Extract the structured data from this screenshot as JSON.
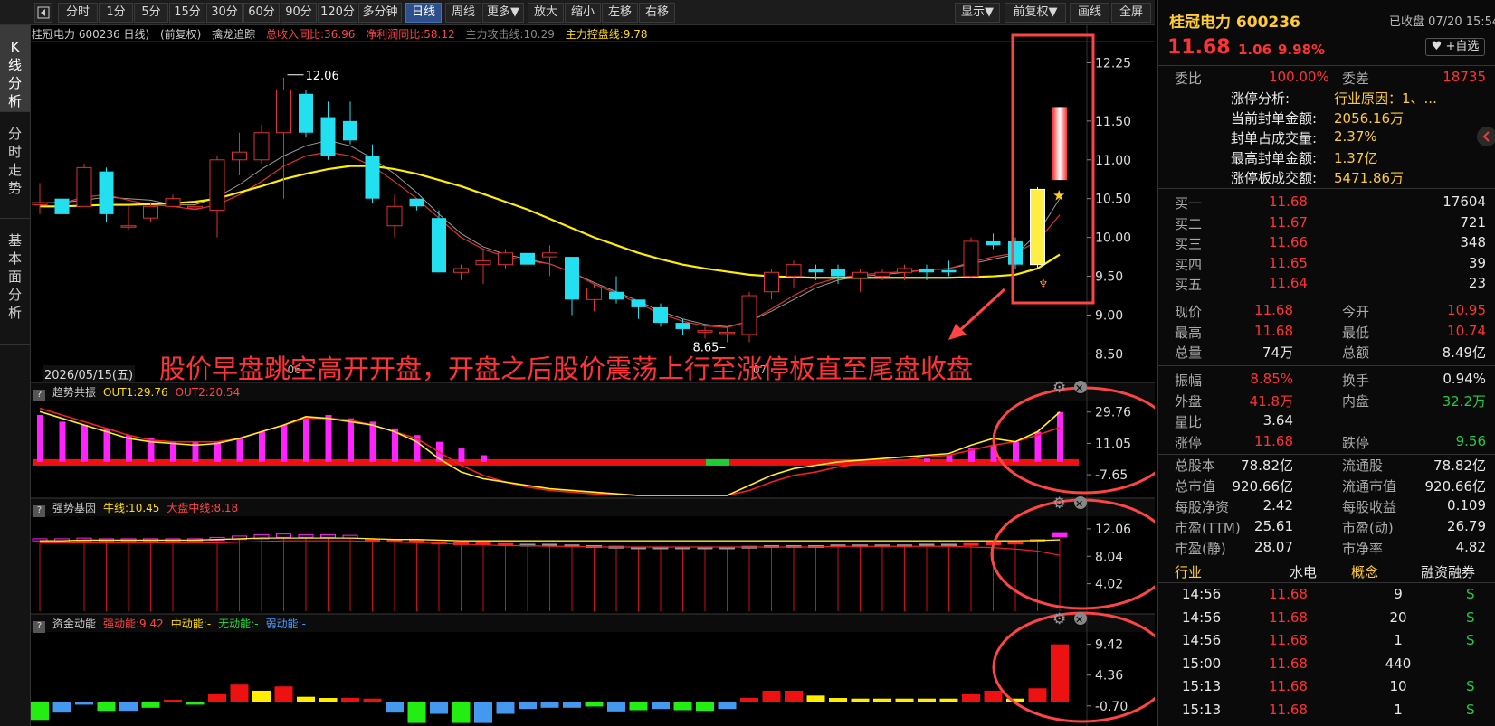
{
  "toolbar": {
    "back_icon": "back-arrow-icon",
    "periods": [
      "分时",
      "1分",
      "5分",
      "15分",
      "30分",
      "60分",
      "90分",
      "120分",
      "多分钟",
      "日线",
      "周线",
      "更多▼",
      "放大",
      "缩小",
      "左移",
      "右移"
    ],
    "active_period": "日线",
    "display": "显示▼",
    "adjust": "前复权▼",
    "draw": "画线",
    "fullscreen": "全屏"
  },
  "side_tabs": [
    "K\n线\n分\n析",
    "分\n时\n走\n势",
    "基\n本\n面\n分\n析"
  ],
  "main_chart": {
    "header_title": "桂冠电力 600236 日线)",
    "header_adjust": "(前复权)",
    "indicator_name": "擒龙追踪",
    "stat1": "总收入同比:36.96",
    "stat2": "净利润同比:58.12",
    "stat3": "主力攻击线:10.29",
    "stat4": "主力控盘线:9.78",
    "high_label": "12.06",
    "low_label": "8.65",
    "date_label": "2026/05/15(五)",
    "tick_06": "06",
    "tick_07": "07",
    "annotation": "股价早盘跳空高开开盘，开盘之后股价震荡上行至涨停板直至尾盘收盘"
  },
  "indicator1": {
    "name": "趋势共振",
    "out1": "OUT1:29.76",
    "out2": "OUT2:20.54",
    "gear_icon": "gear-icon",
    "close_icon": "close-icon"
  },
  "indicator2": {
    "name": "强势基因",
    "l1": "牛线:10.45",
    "l2": "大盘中线:8.18",
    "gear_icon": "gear-icon",
    "close_icon": "close-icon"
  },
  "indicator3": {
    "name": "资金动能",
    "l1": "强动能:9.42",
    "l2": "中动能:-",
    "l3": "无动能:-",
    "l4": "弱动能:-",
    "gear_icon": "gear-icon",
    "close_icon": "close-icon"
  },
  "chart_data": [
    {
      "type": "candlestick",
      "title": "桂冠电力 600236 日线",
      "y_ticks": [
        12.25,
        11.5,
        11.0,
        10.5,
        10.0,
        9.5,
        9.0,
        8.5
      ],
      "y_tick_labels": [
        "12.25",
        "11.50",
        "11.00",
        "10.50",
        "10.00",
        "9.50",
        "9.00",
        "8.50"
      ],
      "ylim": [
        8.4,
        12.5
      ],
      "ohlc": [
        [
          10.42,
          10.7,
          10.3,
          10.45
        ],
        [
          10.5,
          10.55,
          10.25,
          10.3
        ],
        [
          10.4,
          10.95,
          10.4,
          10.9
        ],
        [
          10.85,
          10.9,
          10.2,
          10.3
        ],
        [
          10.15,
          10.4,
          10.1,
          10.15
        ],
        [
          10.25,
          10.45,
          10.2,
          10.4
        ],
        [
          10.4,
          10.55,
          10.4,
          10.5
        ],
        [
          10.38,
          10.6,
          10.05,
          10.4
        ],
        [
          10.35,
          11.05,
          10.0,
          11.0
        ],
        [
          11.0,
          11.35,
          10.8,
          11.1
        ],
        [
          11.0,
          11.45,
          10.95,
          11.35
        ],
        [
          11.35,
          12.06,
          10.5,
          11.9
        ],
        [
          11.85,
          11.9,
          11.3,
          11.35
        ],
        [
          11.55,
          11.75,
          11.0,
          11.05
        ],
        [
          11.5,
          11.75,
          11.2,
          11.25
        ],
        [
          11.05,
          11.2,
          10.45,
          10.5
        ],
        [
          10.15,
          10.55,
          10.0,
          10.4
        ],
        [
          10.5,
          10.5,
          10.35,
          10.4
        ],
        [
          10.25,
          10.35,
          9.55,
          9.55
        ],
        [
          9.55,
          9.65,
          9.45,
          9.6
        ],
        [
          9.65,
          9.85,
          9.4,
          9.7
        ],
        [
          9.65,
          9.85,
          9.6,
          9.8
        ],
        [
          9.8,
          9.8,
          9.65,
          9.65
        ],
        [
          9.75,
          9.9,
          9.5,
          9.8
        ],
        [
          9.75,
          9.75,
          9.0,
          9.2
        ],
        [
          9.2,
          9.4,
          9.05,
          9.35
        ],
        [
          9.3,
          9.5,
          9.15,
          9.2
        ],
        [
          9.2,
          9.2,
          8.95,
          9.1
        ],
        [
          9.1,
          9.15,
          8.85,
          8.9
        ],
        [
          8.9,
          8.95,
          8.75,
          8.82
        ],
        [
          8.78,
          8.85,
          8.7,
          8.8
        ],
        [
          8.78,
          8.85,
          8.65,
          8.78
        ],
        [
          8.75,
          9.3,
          8.65,
          9.25
        ],
        [
          9.3,
          9.6,
          9.2,
          9.55
        ],
        [
          9.5,
          9.7,
          9.35,
          9.65
        ],
        [
          9.6,
          9.65,
          9.45,
          9.55
        ],
        [
          9.6,
          9.65,
          9.4,
          9.5
        ],
        [
          9.48,
          9.6,
          9.3,
          9.55
        ],
        [
          9.5,
          9.6,
          9.45,
          9.55
        ],
        [
          9.55,
          9.65,
          9.45,
          9.6
        ],
        [
          9.6,
          9.65,
          9.45,
          9.55
        ],
        [
          9.58,
          9.7,
          9.5,
          9.55
        ],
        [
          9.5,
          10.0,
          9.48,
          9.95
        ],
        [
          9.95,
          10.05,
          9.85,
          9.9
        ],
        [
          9.95,
          10.0,
          9.6,
          9.65
        ],
        [
          9.65,
          10.65,
          9.6,
          10.62
        ],
        [
          10.95,
          11.68,
          10.74,
          11.68
        ]
      ],
      "ma_gray": [
        10.45,
        10.45,
        10.48,
        10.52,
        10.5,
        10.48,
        10.42,
        10.42,
        10.52,
        10.68,
        10.88,
        11.05,
        11.18,
        11.25,
        11.18,
        11.02,
        10.82,
        10.58,
        10.3,
        10.05,
        9.88,
        9.78,
        9.72,
        9.66,
        9.55,
        9.42,
        9.3,
        9.18,
        9.05,
        8.95,
        8.88,
        8.85,
        8.92,
        9.05,
        9.2,
        9.35,
        9.45,
        9.5,
        9.52,
        9.55,
        9.58,
        9.6,
        9.66,
        9.72,
        9.78,
        10.05,
        10.5
      ],
      "ma_red": [
        10.45,
        10.44,
        10.52,
        10.55,
        10.48,
        10.42,
        10.4,
        10.36,
        10.42,
        10.55,
        10.72,
        10.92,
        11.05,
        11.1,
        11.05,
        10.92,
        10.72,
        10.5,
        10.25,
        10.0,
        9.85,
        9.75,
        9.7,
        9.66,
        9.55,
        9.4,
        9.28,
        9.15,
        9.02,
        8.92,
        8.86,
        8.84,
        8.92,
        9.08,
        9.25,
        9.4,
        9.48,
        9.52,
        9.54,
        9.56,
        9.58,
        9.6,
        9.68,
        9.75,
        9.8,
        9.95,
        10.29
      ],
      "ma_yellow": [
        10.4,
        10.4,
        10.41,
        10.42,
        10.42,
        10.43,
        10.44,
        10.46,
        10.5,
        10.58,
        10.66,
        10.75,
        10.82,
        10.88,
        10.92,
        10.92,
        10.88,
        10.82,
        10.74,
        10.66,
        10.56,
        10.46,
        10.36,
        10.24,
        10.12,
        10.0,
        9.9,
        9.8,
        9.72,
        9.65,
        9.6,
        9.56,
        9.52,
        9.5,
        9.49,
        9.48,
        9.48,
        9.48,
        9.48,
        9.48,
        9.48,
        9.48,
        9.49,
        9.5,
        9.52,
        9.6,
        9.78
      ]
    },
    {
      "type": "bar",
      "title": "趋势共振",
      "y_tick_labels": [
        "29.76",
        "11.05",
        "-7.65"
      ],
      "ylim": [
        -20,
        35
      ],
      "values": [
        28,
        24,
        22,
        20,
        16,
        14,
        12,
        12,
        12,
        14,
        18,
        22,
        26,
        28,
        26,
        24,
        20,
        16,
        12,
        8,
        4,
        0,
        -4,
        -8,
        -12,
        -16,
        -20,
        -20,
        -20,
        -20,
        -20,
        -20,
        -18,
        -14,
        -10,
        -8,
        -6,
        -4,
        -2,
        0,
        2,
        4,
        8,
        10,
        12,
        18,
        29.76
      ],
      "line_yellow": [
        30,
        26,
        22,
        18,
        14,
        12,
        11,
        10,
        11,
        14,
        18,
        22,
        27,
        26,
        24,
        22,
        18,
        12,
        2,
        -6,
        -10,
        -12,
        -14,
        -16,
        -17,
        -18,
        -19,
        -20,
        -20,
        -20,
        -20,
        -20,
        -14,
        -8,
        -4,
        -2,
        0,
        1,
        2,
        3,
        4,
        5,
        10,
        14,
        12,
        18,
        29.76
      ],
      "line_red": [
        32,
        28,
        24,
        20,
        16,
        13,
        12,
        12,
        12,
        14,
        18,
        22,
        26,
        26,
        25,
        22,
        18,
        14,
        6,
        -2,
        -8,
        -12,
        -15,
        -17,
        -18,
        -19,
        -19,
        -20,
        -20,
        -20,
        -20,
        -20,
        -17,
        -12,
        -8,
        -6,
        -3,
        -1,
        0,
        1,
        3,
        4,
        7,
        10,
        12,
        16,
        20.54
      ]
    },
    {
      "type": "bar",
      "title": "强势基因",
      "y_tick_labels": [
        "12.06",
        "8.04",
        "4.02"
      ],
      "ylim": [
        0,
        13.5
      ],
      "body_top": [
        10.6,
        10.6,
        10.7,
        10.6,
        10.6,
        10.6,
        10.6,
        10.6,
        10.8,
        11.0,
        11.2,
        11.3,
        11.2,
        11.2,
        11.1,
        10.5,
        10.5,
        10.4,
        10.1,
        10.0,
        10.0,
        9.9,
        9.8,
        9.8,
        9.7,
        9.6,
        9.5,
        9.4,
        9.4,
        9.4,
        9.4,
        9.4,
        9.5,
        9.6,
        9.6,
        9.6,
        9.7,
        9.7,
        9.7,
        9.7,
        9.8,
        9.8,
        9.9,
        10.0,
        10.1,
        10.5,
        11.5
      ],
      "body_bottom": [
        10.3,
        10.3,
        10.3,
        10.3,
        10.3,
        10.3,
        10.3,
        10.3,
        10.4,
        10.5,
        10.6,
        10.8,
        10.8,
        10.8,
        10.7,
        10.2,
        10.2,
        10.1,
        9.9,
        9.8,
        9.8,
        9.7,
        9.6,
        9.6,
        9.5,
        9.4,
        9.3,
        9.2,
        9.2,
        9.2,
        9.2,
        9.2,
        9.3,
        9.4,
        9.4,
        9.4,
        9.5,
        9.5,
        9.5,
        9.5,
        9.6,
        9.6,
        9.7,
        9.8,
        9.9,
        10.2,
        10.9
      ],
      "line_yellow": [
        10.3,
        10.3,
        10.4,
        10.4,
        10.4,
        10.4,
        10.4,
        10.4,
        10.5,
        10.6,
        10.7,
        10.7,
        10.7,
        10.7,
        10.7,
        10.6,
        10.5,
        10.5,
        10.4,
        10.3,
        10.3,
        10.3,
        10.3,
        10.3,
        10.3,
        10.3,
        10.3,
        10.3,
        10.3,
        10.3,
        10.3,
        10.3,
        10.3,
        10.3,
        10.3,
        10.3,
        10.3,
        10.3,
        10.3,
        10.3,
        10.3,
        10.3,
        10.3,
        10.3,
        10.3,
        10.35,
        10.45
      ],
      "line_red": [
        10.0,
        10.0,
        10.0,
        10.0,
        10.0,
        10.0,
        10.0,
        10.0,
        10.0,
        10.1,
        10.2,
        10.3,
        10.3,
        10.3,
        10.3,
        10.2,
        10.1,
        10.0,
        9.9,
        9.8,
        9.7,
        9.6,
        9.6,
        9.5,
        9.5,
        9.4,
        9.4,
        9.4,
        9.4,
        9.4,
        9.4,
        9.4,
        9.4,
        9.4,
        9.4,
        9.4,
        9.5,
        9.5,
        9.5,
        9.5,
        9.5,
        9.5,
        9.4,
        9.3,
        9.1,
        8.8,
        8.18
      ]
    },
    {
      "type": "bar",
      "title": "资金动能",
      "y_tick_labels": [
        "9.42",
        "4.36",
        "-0.70"
      ],
      "ylim": [
        -4,
        11
      ],
      "values": [
        -3,
        -1.8,
        -0.5,
        -1.5,
        -1.5,
        -1.0,
        0.3,
        -0.5,
        1.2,
        2.8,
        1.8,
        2.5,
        0.8,
        0.6,
        0.6,
        0.5,
        -1.8,
        -3.5,
        -2,
        -3.5,
        -3.5,
        -2,
        -1.2,
        -1,
        -1,
        -0.8,
        -1.6,
        -1.4,
        -1.2,
        -1.4,
        -1.5,
        -1.2,
        0.6,
        1.8,
        1.8,
        1.0,
        0.6,
        0.5,
        0.5,
        0.5,
        0.5,
        0.5,
        1.2,
        1.8,
        0.5,
        2.2,
        9.42
      ],
      "colors": [
        "g",
        "b",
        "b",
        "g",
        "b",
        "g",
        "r",
        "g",
        "r",
        "r",
        "y",
        "r",
        "y",
        "y",
        "r",
        "r",
        "b",
        "g",
        "b",
        "g",
        "b",
        "b",
        "b",
        "b",
        "b",
        "g",
        "b",
        "g",
        "b",
        "g",
        "g",
        "b",
        "r",
        "r",
        "r",
        "y",
        "y",
        "y",
        "y",
        "y",
        "y",
        "y",
        "r",
        "r",
        "y",
        "r",
        "r"
      ]
    }
  ],
  "right_panel": {
    "stock_name": "桂冠电力 600236",
    "status": "已收盘 07/20 15:54",
    "price": "11.68",
    "change": "1.06",
    "change_pct": "9.98%",
    "fav_button": "♥ +自选",
    "weibi_label": "委比",
    "weibi_value": "100.00%",
    "weicha_label": "委差",
    "weicha_value": "18735",
    "limit_lines": [
      {
        "label": "涨停分析:",
        "value": "行业原因：1、..."
      },
      {
        "label": "当前封单金额:",
        "value": "2056.16万"
      },
      {
        "label": "封单占成交量:",
        "value": "2.37%"
      },
      {
        "label": "最高封单金额:",
        "value": "1.37亿"
      },
      {
        "label": "涨停板成交额:",
        "value": "5471.86万"
      }
    ],
    "bids": [
      {
        "label": "买一",
        "price": "11.68",
        "vol": "17604"
      },
      {
        "label": "买二",
        "price": "11.67",
        "vol": "721"
      },
      {
        "label": "买三",
        "price": "11.66",
        "vol": "348"
      },
      {
        "label": "买四",
        "price": "11.65",
        "vol": "39"
      },
      {
        "label": "买五",
        "price": "11.64",
        "vol": "23"
      }
    ],
    "quote_rows": [
      {
        "l1": "现价",
        "v1": "11.68",
        "c1": "red",
        "l2": "今开",
        "v2": "10.95",
        "c2": "red"
      },
      {
        "l1": "最高",
        "v1": "11.68",
        "c1": "red",
        "l2": "最低",
        "v2": "10.74",
        "c2": "red"
      },
      {
        "l1": "总量",
        "v1": "74万",
        "c1": "white",
        "l2": "总额",
        "v2": "8.49亿",
        "c2": "white"
      }
    ],
    "stats_rows": [
      {
        "l1": "振幅",
        "v1": "8.85%",
        "c1": "red",
        "l2": "换手",
        "v2": "0.94%",
        "c2": "white"
      },
      {
        "l1": "外盘",
        "v1": "41.8万",
        "c1": "red",
        "l2": "内盘",
        "v2": "32.2万",
        "c2": "green"
      },
      {
        "l1": "量比",
        "v1": "3.64",
        "c1": "white",
        "l2": "",
        "v2": "",
        "c2": "white"
      },
      {
        "l1": "涨停",
        "v1": "11.68",
        "c1": "red",
        "l2": "跌停",
        "v2": "9.56",
        "c2": "green"
      }
    ],
    "fund_rows": [
      {
        "l1": "总股本",
        "v1": "78.82亿",
        "l2": "流通股",
        "v2": "78.82亿"
      },
      {
        "l1": "总市值",
        "v1": "920.66亿",
        "l2": "流通市值",
        "v2": "920.66亿"
      },
      {
        "l1": "每股净资",
        "v1": "2.42",
        "l2": "每股收益",
        "v2": "0.109"
      },
      {
        "l1": "市盈(TTM)",
        "v1": "25.61",
        "l2": "市盈(动)",
        "v2": "26.79"
      },
      {
        "l1": "市盈(静)",
        "v1": "28.07",
        "l2": "市净率",
        "v2": "4.82"
      }
    ],
    "tags": [
      "行业",
      "水电",
      "概念",
      "融资融券"
    ],
    "trades": [
      {
        "time": "14:56",
        "price": "11.68",
        "vol": "9",
        "side": "S"
      },
      {
        "time": "14:56",
        "price": "11.68",
        "vol": "20",
        "side": "S"
      },
      {
        "time": "14:56",
        "price": "11.68",
        "vol": "1",
        "side": "S"
      },
      {
        "time": "15:00",
        "price": "11.68",
        "vol": "440",
        "side": ""
      },
      {
        "time": "15:13",
        "price": "11.68",
        "vol": "10",
        "side": "S"
      },
      {
        "time": "15:13",
        "price": "11.68",
        "vol": "1",
        "side": "S"
      }
    ],
    "collapse_icon": "chevron-left-icon"
  }
}
